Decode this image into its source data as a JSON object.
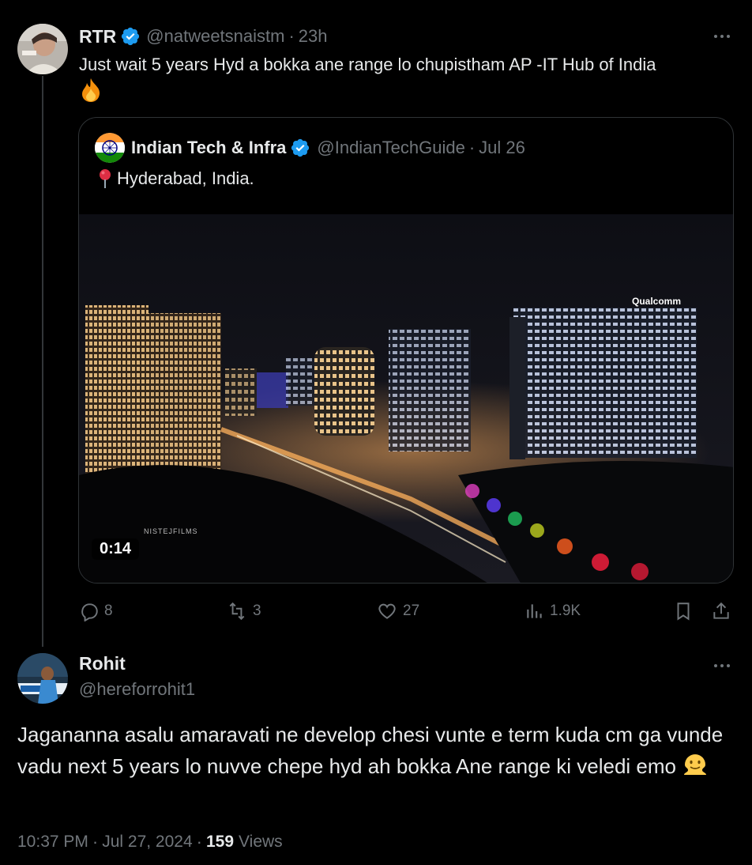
{
  "tweet1": {
    "name": "RTR",
    "handle": "@natweetsnaistm",
    "separator": "·",
    "time": "23h",
    "text": "Just wait 5 years Hyd a bokka ane range lo chupistham AP -IT Hub  of India",
    "emoji": "fire-emoji"
  },
  "quote": {
    "name": "Indian Tech & Infra",
    "handle": "@IndianTechGuide",
    "separator": "·",
    "date": "Jul 26",
    "text": "Hyderabad, India.",
    "video": {
      "duration": "0:14",
      "watermark": "NISTEJFILMS",
      "sign": "Qualcomm"
    }
  },
  "actions": {
    "replies": "8",
    "reposts": "3",
    "likes": "27",
    "views": "1.9K"
  },
  "tweet2": {
    "name": "Rohit",
    "handle": "@hereforrohit1",
    "text": "Jagananna asalu amaravati ne develop chesi vunte  e term kuda cm ga vunde vadu next 5 years lo nuvve chepe hyd ah bokka Ane range ki veledi emo",
    "emoji": "melting-face-emoji",
    "time": "10:37 PM",
    "separator": "·",
    "date": "Jul 27, 2024",
    "views_count": "159",
    "views_label": "Views"
  },
  "colors": {
    "background": "#000000",
    "text": "#e7e9ea",
    "muted": "#71767b",
    "verified": "#1d9bf0",
    "border": "#2f3336"
  }
}
